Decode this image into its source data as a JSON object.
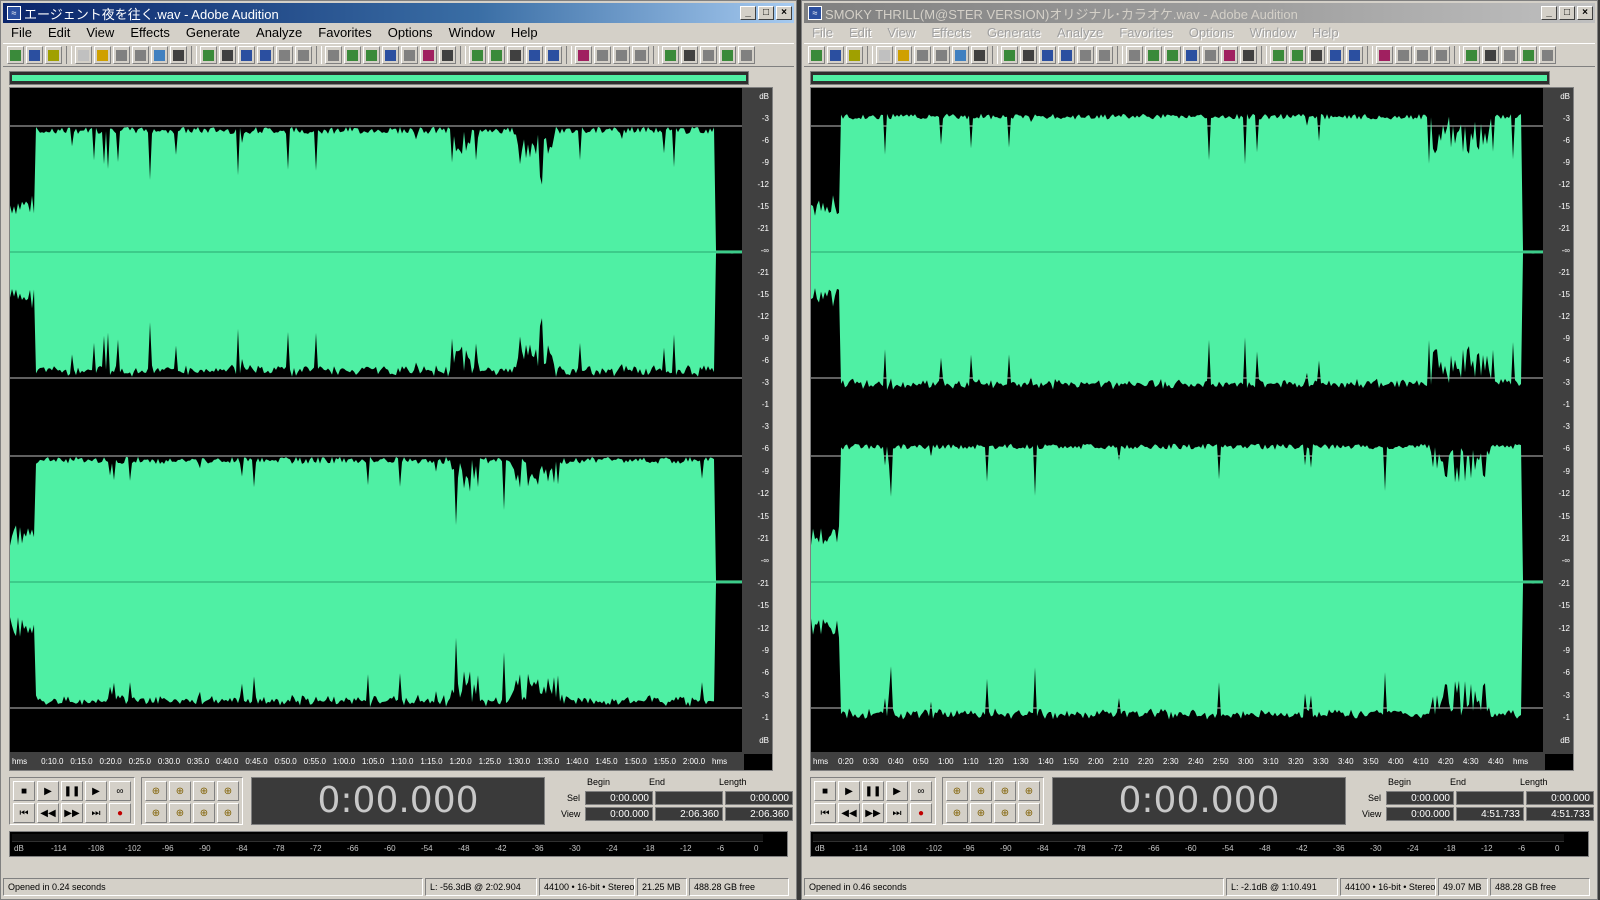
{
  "colors": {
    "waveform": "#4ff0a4",
    "background": "#000000"
  },
  "menus": [
    "File",
    "Edit",
    "View",
    "Effects",
    "Generate",
    "Analyze",
    "Favorites",
    "Options",
    "Window",
    "Help"
  ],
  "db_labels": [
    "dB",
    "-3",
    "-6",
    "-9",
    "-12",
    "-15",
    "-21",
    "-∞",
    "-21",
    "-15",
    "-12",
    "-9",
    "-6",
    "-3",
    "-1"
  ],
  "level_labels": [
    "dB",
    "-114",
    "-108",
    "-102",
    "-96",
    "-90",
    "-84",
    "-78",
    "-72",
    "-66",
    "-60",
    "-54",
    "-48",
    "-42",
    "-36",
    "-30",
    "-24",
    "-18",
    "-12",
    "-6",
    "0"
  ],
  "sel_labels": {
    "begin": "Begin",
    "end": "End",
    "length": "Length",
    "sel": "Sel",
    "view": "View"
  },
  "windows": [
    {
      "title": "エージェント夜を往く.wav - Adobe Audition",
      "active": true,
      "time": "0:00.000",
      "sel_begin": "0:00.000",
      "sel_end": "",
      "sel_length": "0:00.000",
      "view_begin": "0:00.000",
      "view_end": "2:06.360",
      "view_length": "2:06.360",
      "time_ticks": [
        "hms",
        "0:10.0",
        "0:15.0",
        "0:20.0",
        "0:25.0",
        "0:30.0",
        "0:35.0",
        "0:40.0",
        "0:45.0",
        "0:50.0",
        "0:55.0",
        "1:00.0",
        "1:05.0",
        "1:10.0",
        "1:15.0",
        "1:20.0",
        "1:25.0",
        "1:30.0",
        "1:35.0",
        "1:40.0",
        "1:45.0",
        "1:50.0",
        "1:55.0",
        "2:00.0",
        "hms"
      ],
      "status": {
        "opened": "Opened in 0.24 seconds",
        "cursor": "L: -56.3dB @   2:02.904",
        "format": "44100 • 16-bit • Stereo",
        "size": "21.25 MB",
        "free": "488.28 GB free"
      }
    },
    {
      "title": "SMOKY THRILL(M@STER VERSION)オリジナル･カラオケ.wav - Adobe Audition",
      "active": false,
      "time": "0:00.000",
      "sel_begin": "0:00.000",
      "sel_end": "",
      "sel_length": "0:00.000",
      "view_begin": "0:00.000",
      "view_end": "4:51.733",
      "view_length": "4:51.733",
      "time_ticks": [
        "hms",
        "0:20",
        "0:30",
        "0:40",
        "0:50",
        "1:00",
        "1:10",
        "1:20",
        "1:30",
        "1:40",
        "1:50",
        "2:00",
        "2:10",
        "2:20",
        "2:30",
        "2:40",
        "2:50",
        "3:00",
        "3:10",
        "3:20",
        "3:30",
        "3:40",
        "3:50",
        "4:00",
        "4:10",
        "4:20",
        "4:30",
        "4:40",
        "hms"
      ],
      "status": {
        "opened": "Opened in 0.46 seconds",
        "cursor": "L: -2.1dB @   1:10.491",
        "format": "44100 • 16-bit • Stereo",
        "size": "49.07 MB",
        "free": "488.28 GB free"
      }
    }
  ]
}
